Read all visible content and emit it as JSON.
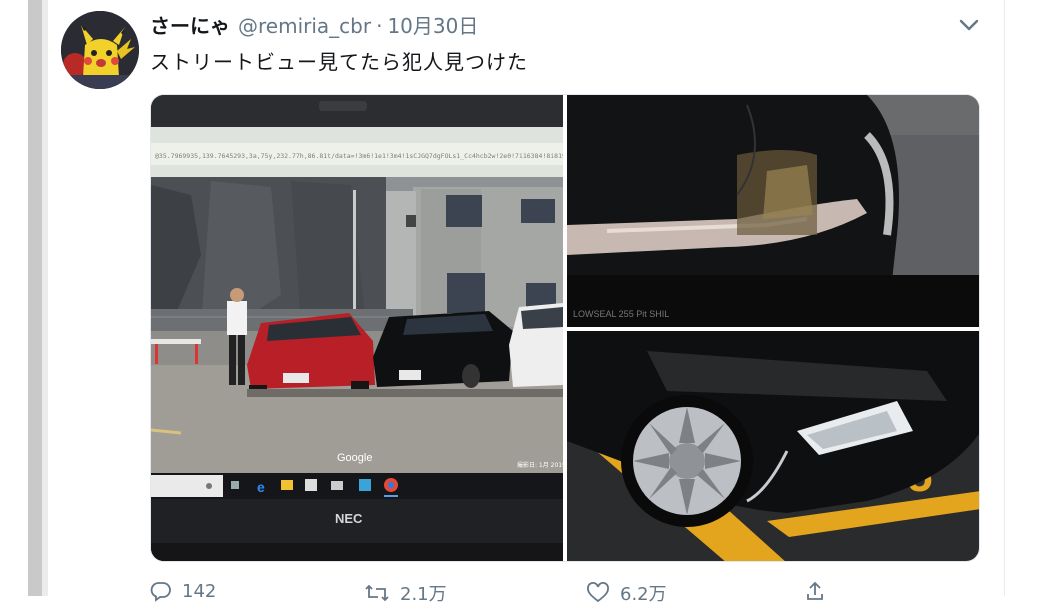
{
  "tweet": {
    "display_name": "さーにゃ",
    "handle": "@remiria_cbr",
    "separator": "·",
    "date": "10月30日",
    "text": "ストリートビュー見てたら犯人見つけた",
    "avatar_icon": "pikachu-avatar-icon",
    "menu_icon": "chevron-down-icon"
  },
  "media": {
    "photo1": {
      "brand": "NEC",
      "google_watermark": "Google",
      "url_text": "@35.7969935,139.7645293,3a,75y,232.77h,86.81t/data=!3m6!1e1!3m4!1sCJGQ7dgFOLs1_Cc4hcb2w!2e0!7i16384!8i8192",
      "image_date": "撮影日: 1月 2019"
    },
    "photo2": {
      "tire_text": "LOWSEAL 255  Pit SHIL"
    },
    "photo3": {
      "lot_number": "5"
    }
  },
  "actions": {
    "reply_icon": "reply-icon",
    "reply_count": "142",
    "retweet_icon": "retweet-icon",
    "retweet_count": "2.1万",
    "like_icon": "heart-icon",
    "like_count": "6.2万",
    "share_icon": "share-icon"
  },
  "colors": {
    "text_primary": "#14171a",
    "text_secondary": "#657786",
    "red_car": "#c0222b",
    "black_car": "#111214"
  }
}
